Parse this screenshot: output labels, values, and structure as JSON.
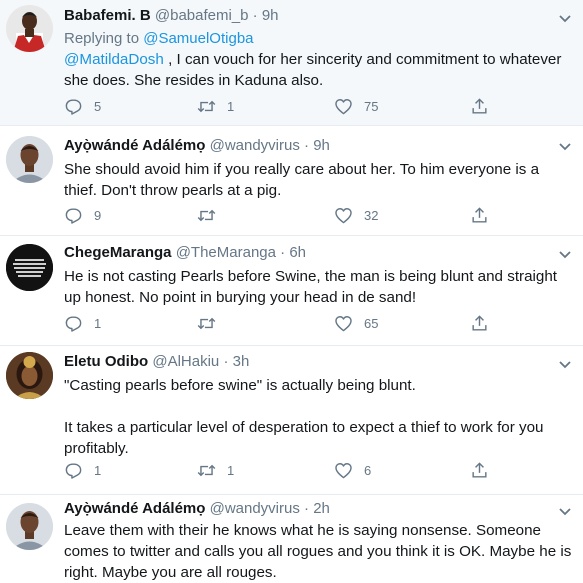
{
  "tweets": [
    {
      "name": "Babafemi. B",
      "handle": "@babafemi_b",
      "time": "9h",
      "replying_label": "Replying to",
      "replying_to": "@SamuelOtigba",
      "mention": "@MatildaDosh",
      "text": " , I can vouch for her sincerity and commitment to whatever she does. She resides in Kaduna also.",
      "replies": "5",
      "retweets": "1",
      "likes": "75"
    },
    {
      "name": "Ayọ̀wándé Adálémọ",
      "handle": "@wandyvirus",
      "time": "9h",
      "text": "She should avoid him if you really care about her. To him everyone is a thief. Don't throw pearls at a pig.",
      "replies": "9",
      "retweets": "",
      "likes": "32"
    },
    {
      "name": "ChegeMaranga",
      "handle": "@TheMaranga",
      "time": "6h",
      "text": "He is not casting Pearls before Swine, the man is being blunt and straight up honest. No point in burying your head in de sand!",
      "replies": "1",
      "retweets": "",
      "likes": "65"
    },
    {
      "name": "Eletu Odibo",
      "handle": "@AlHakiu",
      "time": "3h",
      "text": "\"Casting pearls before swine\" is actually being blunt.\n\nIt takes a particular level of desperation to expect a thief to work for you profitably.",
      "replies": "1",
      "retweets": "1",
      "likes": "6"
    },
    {
      "name": "Ayọ̀wándé Adálémọ",
      "handle": "@wandyvirus",
      "time": "2h",
      "text": "Leave them with their he knows what he is saying nonsense. Someone comes to twitter and calls you all rogues and you think it is OK. Maybe he is right. Maybe you are all rouges."
    }
  ],
  "separator": "·",
  "colors": {
    "link": "#1b95e0",
    "muted": "#657786",
    "text": "#14171a",
    "highlight_bg": "#f5f8fa"
  }
}
